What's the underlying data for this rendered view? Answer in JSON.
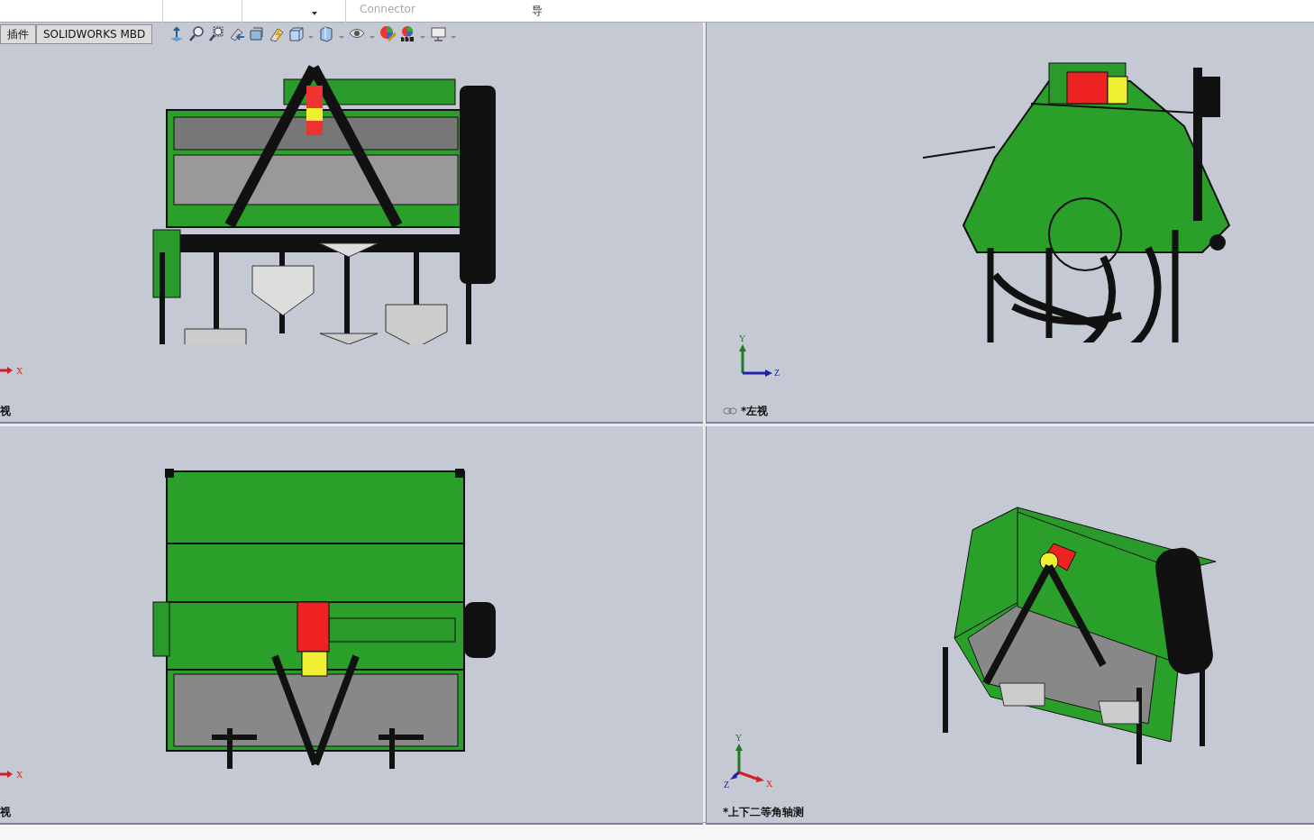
{
  "ribbon": {
    "items": [
      {
        "label": "Connector",
        "disabled": true
      },
      {
        "label": "导",
        "disabled": false
      }
    ]
  },
  "tabs": [
    {
      "label": "插件",
      "selected": false
    },
    {
      "label": "SOLIDWORKS MBD",
      "selected": false
    }
  ],
  "viewports": [
    {
      "kind": "front",
      "label": "视",
      "linked": false,
      "triad": {
        "kind": "x",
        "axes": [
          "X"
        ]
      }
    },
    {
      "kind": "left",
      "label": "*左视",
      "linked": true,
      "triad": {
        "kind": "yz",
        "axes": [
          "Y",
          "Z"
        ]
      }
    },
    {
      "kind": "top",
      "label": "视",
      "linked": false,
      "triad": {
        "kind": "x",
        "axes": [
          "X"
        ]
      }
    },
    {
      "kind": "iso",
      "label": "*上下二等角轴测",
      "linked": false,
      "triad": {
        "kind": "iso",
        "axes": [
          "Y",
          "Z",
          "X"
        ]
      }
    }
  ]
}
